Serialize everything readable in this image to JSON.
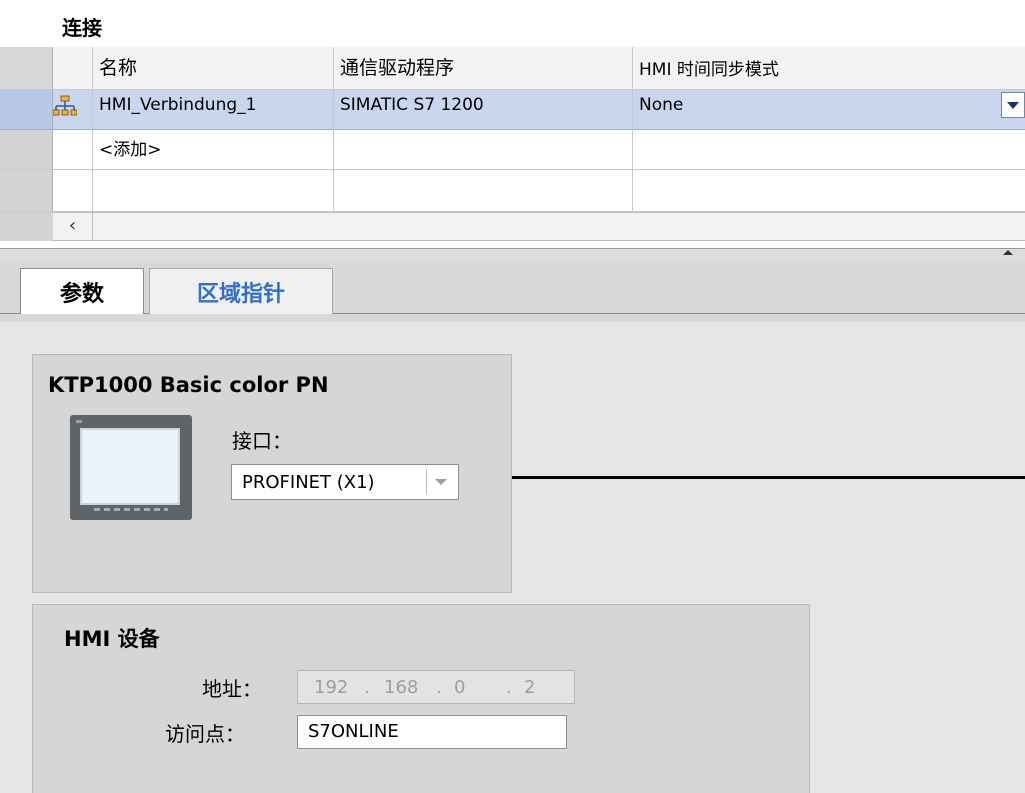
{
  "connections": {
    "title": "连接",
    "columns": [
      "名称",
      "通信驱动程序",
      "HMI 时间同步模式"
    ],
    "rows": [
      {
        "name": "HMI_Verbindung_1",
        "driver": "SIMATIC S7 1200",
        "sync": "None",
        "icon": "network-connection-icon"
      },
      {
        "name": "<添加>",
        "driver": "",
        "sync": ""
      }
    ]
  },
  "tabs": {
    "params": "参数",
    "area_pointer": "区域指针"
  },
  "device": {
    "title": "KTP1000 Basic color PN",
    "interface_label": "接口：",
    "interface_value": "PROFINET (X1)"
  },
  "hmi": {
    "title": "HMI 设备",
    "address_label": "地址：",
    "ip": [
      "192",
      "168",
      "0",
      "2"
    ],
    "access_point_label": "访问点：",
    "access_point_value": "S7ONLINE"
  },
  "colors": {
    "selected_row": "#c8d6ee",
    "tab_link": "#2f6fd0",
    "panel_bg": "#d6d6d6"
  }
}
